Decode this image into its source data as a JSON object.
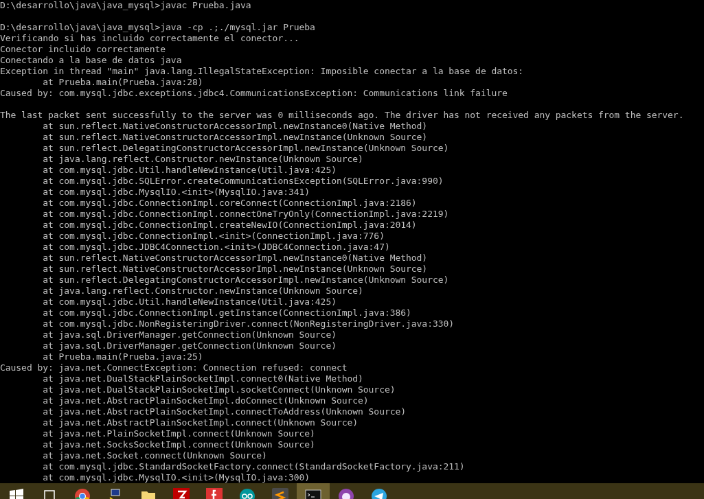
{
  "console": {
    "blocks": [
      [
        "D:\\desarrollo\\java\\java_mysql>javac Prueba.java"
      ],
      [
        "D:\\desarrollo\\java\\java_mysql>java -cp .;./mysql.jar Prueba",
        "Verificando si has incluido correctamente el conector...",
        "Conector incluido correctamente",
        "Conectando a la base de datos java",
        "Exception in thread \"main\" java.lang.IllegalStateException: Imposible conectar a la base de datos:",
        "\tat Prueba.main(Prueba.java:28)",
        "Caused by: com.mysql.jdbc.exceptions.jdbc4.CommunicationsException: Communications link failure"
      ],
      [
        "The last packet sent successfully to the server was 0 milliseconds ago. The driver has not received any packets from the server.",
        "\tat sun.reflect.NativeConstructorAccessorImpl.newInstance0(Native Method)",
        "\tat sun.reflect.NativeConstructorAccessorImpl.newInstance(Unknown Source)",
        "\tat sun.reflect.DelegatingConstructorAccessorImpl.newInstance(Unknown Source)",
        "\tat java.lang.reflect.Constructor.newInstance(Unknown Source)",
        "\tat com.mysql.jdbc.Util.handleNewInstance(Util.java:425)",
        "\tat com.mysql.jdbc.SQLError.createCommunicationsException(SQLError.java:990)",
        "\tat com.mysql.jdbc.MysqlIO.<init>(MysqlIO.java:341)",
        "\tat com.mysql.jdbc.ConnectionImpl.coreConnect(ConnectionImpl.java:2186)",
        "\tat com.mysql.jdbc.ConnectionImpl.connectOneTryOnly(ConnectionImpl.java:2219)",
        "\tat com.mysql.jdbc.ConnectionImpl.createNewIO(ConnectionImpl.java:2014)",
        "\tat com.mysql.jdbc.ConnectionImpl.<init>(ConnectionImpl.java:776)",
        "\tat com.mysql.jdbc.JDBC4Connection.<init>(JDBC4Connection.java:47)",
        "\tat sun.reflect.NativeConstructorAccessorImpl.newInstance0(Native Method)",
        "\tat sun.reflect.NativeConstructorAccessorImpl.newInstance(Unknown Source)",
        "\tat sun.reflect.DelegatingConstructorAccessorImpl.newInstance(Unknown Source)",
        "\tat java.lang.reflect.Constructor.newInstance(Unknown Source)",
        "\tat com.mysql.jdbc.Util.handleNewInstance(Util.java:425)",
        "\tat com.mysql.jdbc.ConnectionImpl.getInstance(ConnectionImpl.java:386)",
        "\tat com.mysql.jdbc.NonRegisteringDriver.connect(NonRegisteringDriver.java:330)",
        "\tat java.sql.DriverManager.getConnection(Unknown Source)",
        "\tat java.sql.DriverManager.getConnection(Unknown Source)",
        "\tat Prueba.main(Prueba.java:25)",
        "Caused by: java.net.ConnectException: Connection refused: connect",
        "\tat java.net.DualStackPlainSocketImpl.connect0(Native Method)",
        "\tat java.net.DualStackPlainSocketImpl.socketConnect(Unknown Source)",
        "\tat java.net.AbstractPlainSocketImpl.doConnect(Unknown Source)",
        "\tat java.net.AbstractPlainSocketImpl.connectToAddress(Unknown Source)",
        "\tat java.net.AbstractPlainSocketImpl.connect(Unknown Source)",
        "\tat java.net.PlainSocketImpl.connect(Unknown Source)",
        "\tat java.net.SocksSocketImpl.connect(Unknown Source)",
        "\tat java.net.Socket.connect(Unknown Source)",
        "\tat com.mysql.jdbc.StandardSocketFactory.connect(StandardSocketFactory.java:211)",
        "\tat com.mysql.jdbc.MysqlIO.<init>(MysqlIO.java:300)"
      ]
    ]
  },
  "taskbar": {
    "items": [
      {
        "kind": "start",
        "selected": false
      },
      {
        "kind": "taskview",
        "selected": false
      },
      {
        "kind": "chrome",
        "selected": false
      },
      {
        "kind": "network",
        "selected": false
      },
      {
        "kind": "folder",
        "selected": false
      },
      {
        "kind": "filezilla",
        "selected": false
      },
      {
        "kind": "redf",
        "selected": false
      },
      {
        "kind": "arduino",
        "selected": false
      },
      {
        "kind": "sublime",
        "selected": false
      },
      {
        "kind": "console",
        "selected": true
      },
      {
        "kind": "purple",
        "selected": false
      },
      {
        "kind": "telegram",
        "selected": false
      }
    ]
  }
}
